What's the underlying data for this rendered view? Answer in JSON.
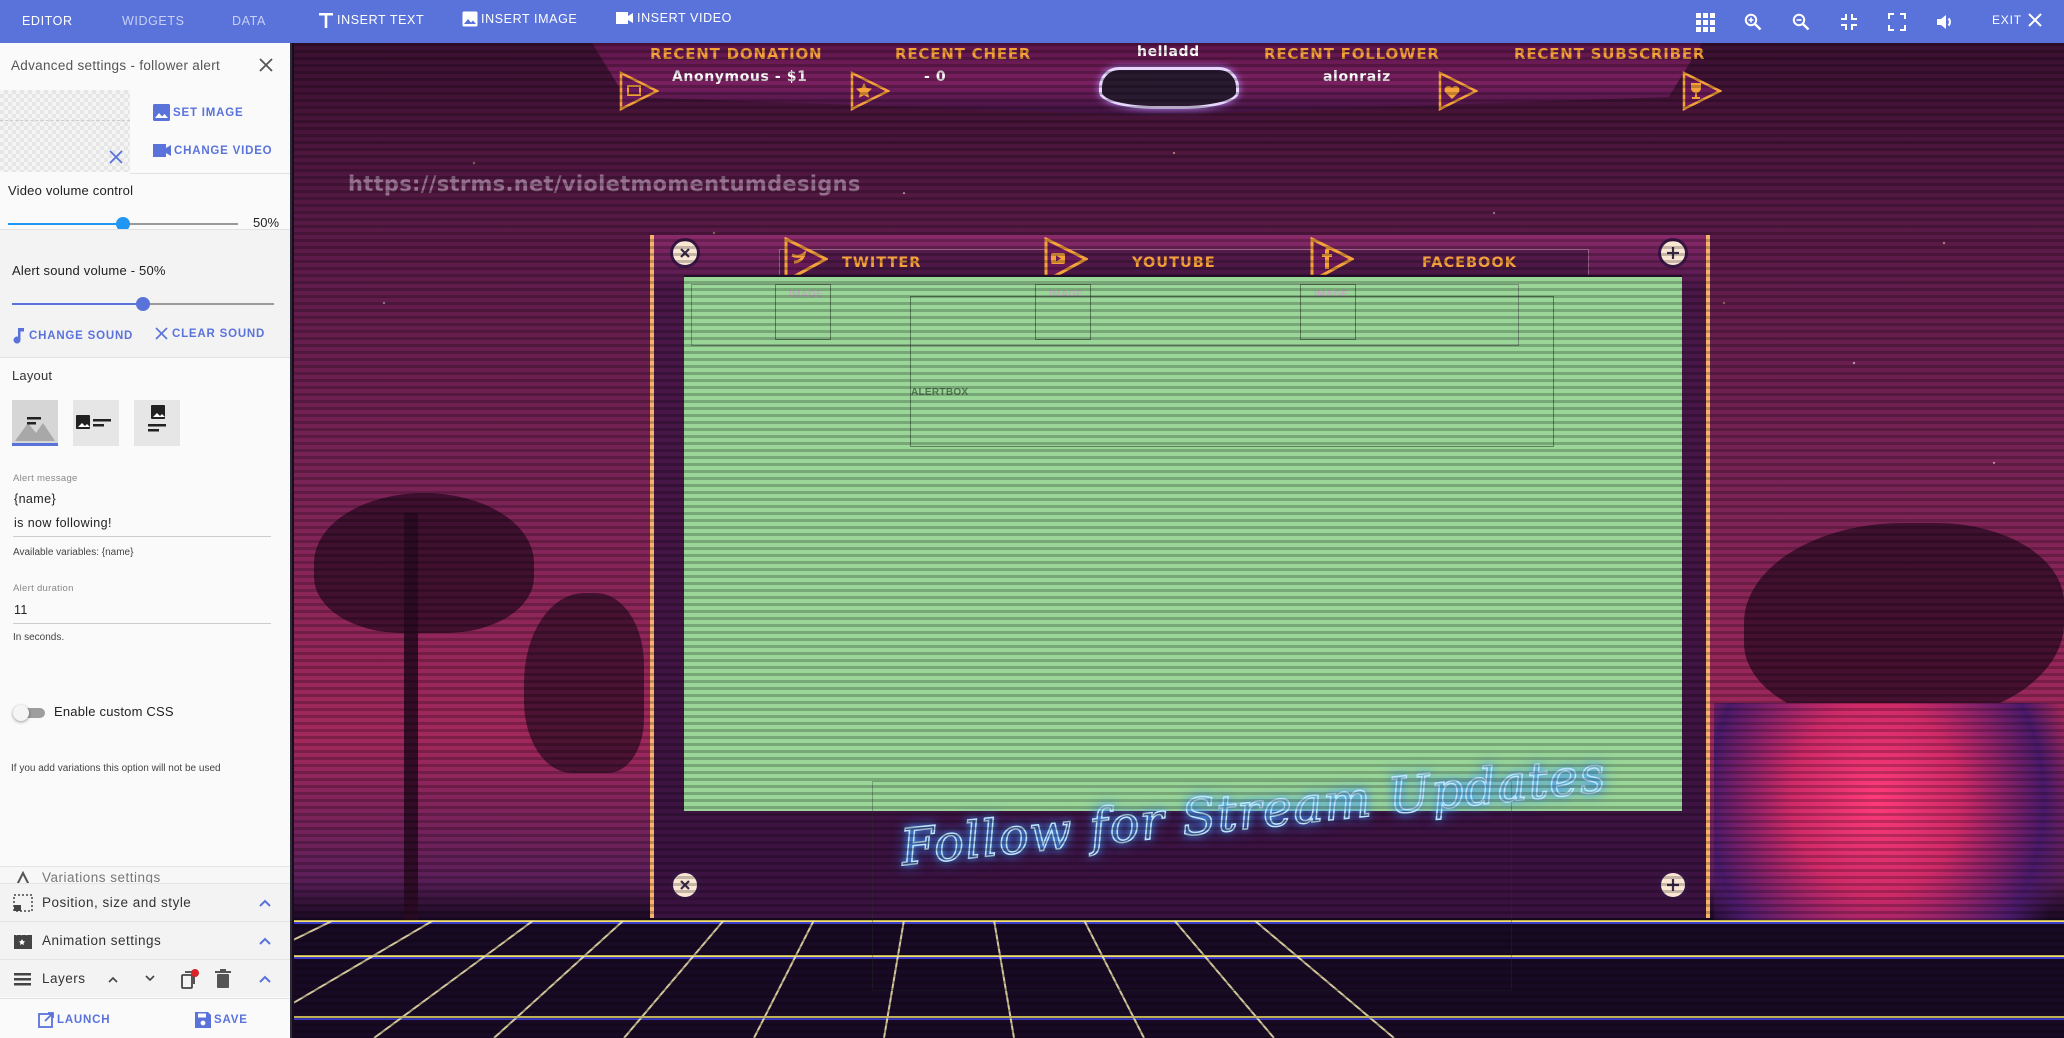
{
  "topbar": {
    "tabs": [
      {
        "label": "EDITOR",
        "active": true
      },
      {
        "label": "WIDGETS",
        "active": false
      },
      {
        "label": "DATA",
        "active": false
      }
    ],
    "insert_text": "INSERT TEXT",
    "insert_image": "INSERT IMAGE",
    "insert_video": "INSERT VIDEO",
    "right_icons": [
      "grid-icon",
      "zoom-in-icon",
      "zoom-out-icon",
      "collapse-icon",
      "fullscreen-icon",
      "volume-icon"
    ],
    "exit_label": "EXIT"
  },
  "sidebar": {
    "title": "Advanced settings - follower alert",
    "set_image": "SET IMAGE",
    "change_video": "CHANGE VIDEO",
    "video_volume_label": "Video volume control",
    "video_volume_value": "50%",
    "video_volume_fraction": 0.5,
    "alert_sound_label": "Alert sound volume - 50%",
    "alert_sound_fraction": 0.5,
    "change_sound": "CHANGE SOUND",
    "clear_sound": "CLEAR SOUND",
    "layout_label": "Layout",
    "layout_options": [
      "text-over-image",
      "image-left-text",
      "image-above-text"
    ],
    "layout_selected": 0,
    "alert_message_label": "Alert message",
    "alert_message_line1": "{name}",
    "alert_message_line2": " is now following!",
    "alert_message_hint": "Available variables: {name}",
    "alert_duration_label": "Alert duration",
    "alert_duration_value": "11",
    "alert_duration_hint": "In seconds.",
    "custom_css_label": "Enable custom CSS",
    "custom_css_enabled": false,
    "variations_note": "If you add variations this option will not be used",
    "accordions": {
      "variations": "Variations settings",
      "position": "Position, size and style",
      "animation": "Animation settings",
      "layers": "Layers"
    },
    "launch": "LAUNCH",
    "save": "SAVE"
  },
  "canvas": {
    "watermark": "https://strms.net/violetmomentumdesigns",
    "info": {
      "recent_donation_title": "RECENT DONATION",
      "recent_donation_value": "Anonymous - $1",
      "recent_cheer_title": "RECENT CHEER",
      "recent_cheer_value": "- 0",
      "center_name": "helladd",
      "recent_follower_title": "RECENT FOLLOWER",
      "recent_follower_value": "alonraiz",
      "recent_subscriber_title": "RECENT SUBSCRIBER"
    },
    "social": [
      "TWITTER",
      "YOUTUBE",
      "FACEBOOK"
    ],
    "image_tag": "IMAGE",
    "alertbox_tag": "ALERTBOX",
    "neon_text": "Follow for Stream Updates",
    "colors": {
      "accent": "#5a73db",
      "green_screen": "#9ad698",
      "banner_orange": "#f6a23a",
      "slider_video": "#2196f3"
    }
  }
}
